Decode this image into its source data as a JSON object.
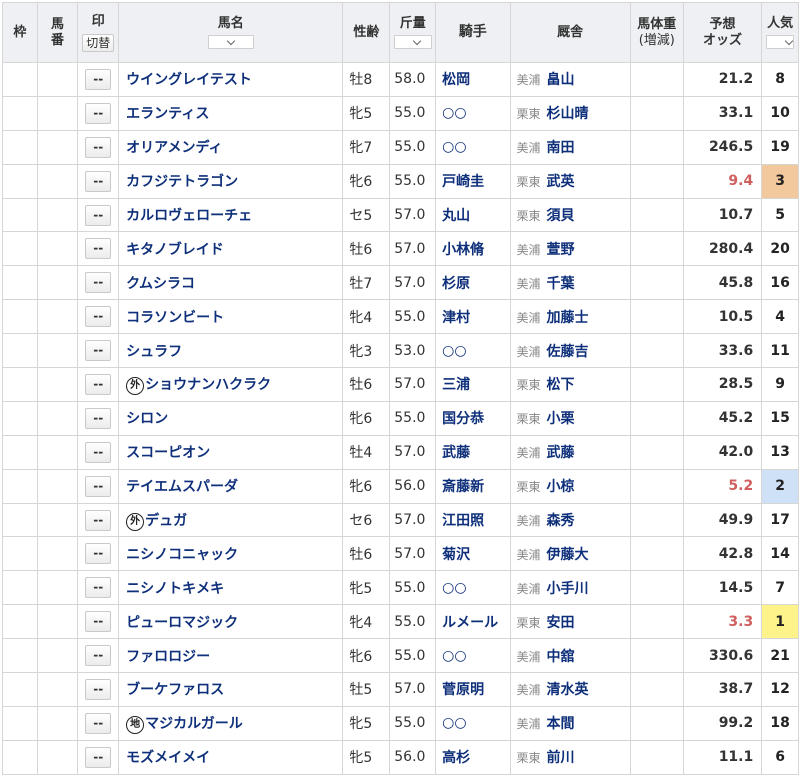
{
  "header": {
    "waku": "枠",
    "umaban": "馬番",
    "mark": "印",
    "toggle": "切替",
    "name": "馬名",
    "age": "性齢",
    "weight": "斤量",
    "jockey": "騎手",
    "stable": "厩舎",
    "bodyweight_line1": "馬体重",
    "bodyweight_line2": "(増減)",
    "odds_line1": "予想",
    "odds_line2": "オッズ",
    "popularity": "人気"
  },
  "mark_placeholder": "--",
  "colors": {
    "link": "#0e2f7a",
    "hot_odds": "#d05f5f",
    "pop1": "#fdf38a",
    "pop2": "#cfe1f7",
    "pop3": "#f2c99d"
  },
  "rows": [
    {
      "badge": "",
      "name": "ウイングレイテスト",
      "age": "牡8",
      "weight": "58.0",
      "jockey": "松岡",
      "region": "美浦",
      "trainer": "畠山",
      "odds": "21.2",
      "pop": "8"
    },
    {
      "badge": "",
      "name": "エランティス",
      "age": "牝5",
      "weight": "55.0",
      "jockey": "○○",
      "region": "栗東",
      "trainer": "杉山晴",
      "odds": "33.1",
      "pop": "10"
    },
    {
      "badge": "",
      "name": "オリアメンディ",
      "age": "牝7",
      "weight": "55.0",
      "jockey": "○○",
      "region": "美浦",
      "trainer": "南田",
      "odds": "246.5",
      "pop": "19"
    },
    {
      "badge": "",
      "name": "カフジテトラゴン",
      "age": "牝6",
      "weight": "55.0",
      "jockey": "戸崎圭",
      "region": "栗東",
      "trainer": "武英",
      "odds": "9.4",
      "pop": "3"
    },
    {
      "badge": "",
      "name": "カルロヴェローチェ",
      "age": "セ5",
      "weight": "57.0",
      "jockey": "丸山",
      "region": "栗東",
      "trainer": "須貝",
      "odds": "10.7",
      "pop": "5"
    },
    {
      "badge": "",
      "name": "キタノブレイド",
      "age": "牡6",
      "weight": "57.0",
      "jockey": "小林脩",
      "region": "美浦",
      "trainer": "萱野",
      "odds": "280.4",
      "pop": "20"
    },
    {
      "badge": "",
      "name": "クムシラコ",
      "age": "牡7",
      "weight": "57.0",
      "jockey": "杉原",
      "region": "美浦",
      "trainer": "千葉",
      "odds": "45.8",
      "pop": "16"
    },
    {
      "badge": "",
      "name": "コラソンビート",
      "age": "牝4",
      "weight": "55.0",
      "jockey": "津村",
      "region": "美浦",
      "trainer": "加藤士",
      "odds": "10.5",
      "pop": "4"
    },
    {
      "badge": "",
      "name": "シュラフ",
      "age": "牝3",
      "weight": "53.0",
      "jockey": "○○",
      "region": "美浦",
      "trainer": "佐藤吉",
      "odds": "33.6",
      "pop": "11"
    },
    {
      "badge": "外",
      "name": "ショウナンハクラク",
      "age": "牡6",
      "weight": "57.0",
      "jockey": "三浦",
      "region": "栗東",
      "trainer": "松下",
      "odds": "28.5",
      "pop": "9"
    },
    {
      "badge": "",
      "name": "シロン",
      "age": "牝6",
      "weight": "55.0",
      "jockey": "国分恭",
      "region": "栗東",
      "trainer": "小栗",
      "odds": "45.2",
      "pop": "15"
    },
    {
      "badge": "",
      "name": "スコーピオン",
      "age": "牡4",
      "weight": "57.0",
      "jockey": "武藤",
      "region": "美浦",
      "trainer": "武藤",
      "odds": "42.0",
      "pop": "13"
    },
    {
      "badge": "",
      "name": "テイエムスパーダ",
      "age": "牝6",
      "weight": "56.0",
      "jockey": "斎藤新",
      "region": "栗東",
      "trainer": "小椋",
      "odds": "5.2",
      "pop": "2"
    },
    {
      "badge": "外",
      "name": "デュガ",
      "age": "セ6",
      "weight": "57.0",
      "jockey": "江田照",
      "region": "美浦",
      "trainer": "森秀",
      "odds": "49.9",
      "pop": "17"
    },
    {
      "badge": "",
      "name": "ニシノコニャック",
      "age": "牡6",
      "weight": "57.0",
      "jockey": "菊沢",
      "region": "美浦",
      "trainer": "伊藤大",
      "odds": "42.8",
      "pop": "14"
    },
    {
      "badge": "",
      "name": "ニシノトキメキ",
      "age": "牝5",
      "weight": "55.0",
      "jockey": "○○",
      "region": "美浦",
      "trainer": "小手川",
      "odds": "14.5",
      "pop": "7"
    },
    {
      "badge": "",
      "name": "ピューロマジック",
      "age": "牝4",
      "weight": "55.0",
      "jockey": "ルメール",
      "region": "栗東",
      "trainer": "安田",
      "odds": "3.3",
      "pop": "1"
    },
    {
      "badge": "",
      "name": "ファロロジー",
      "age": "牝6",
      "weight": "55.0",
      "jockey": "○○",
      "region": "美浦",
      "trainer": "中舘",
      "odds": "330.6",
      "pop": "21"
    },
    {
      "badge": "",
      "name": "ブーケファロス",
      "age": "牡5",
      "weight": "57.0",
      "jockey": "菅原明",
      "region": "美浦",
      "trainer": "清水英",
      "odds": "38.7",
      "pop": "12"
    },
    {
      "badge": "地",
      "name": "マジカルガール",
      "age": "牝5",
      "weight": "55.0",
      "jockey": "○○",
      "region": "美浦",
      "trainer": "本間",
      "odds": "99.2",
      "pop": "18"
    },
    {
      "badge": "",
      "name": "モズメイメイ",
      "age": "牝5",
      "weight": "56.0",
      "jockey": "高杉",
      "region": "栗東",
      "trainer": "前川",
      "odds": "11.1",
      "pop": "6"
    }
  ]
}
